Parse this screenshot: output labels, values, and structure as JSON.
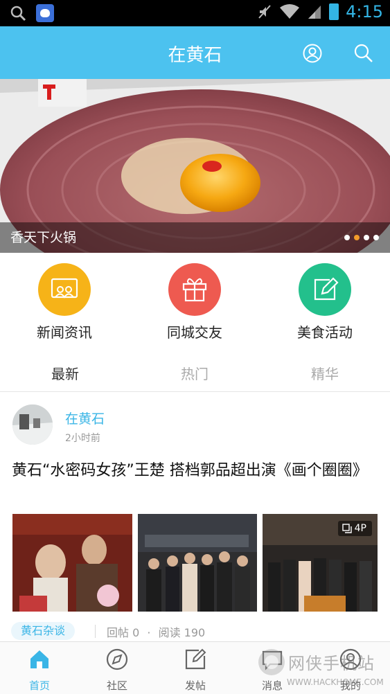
{
  "status_bar": {
    "time": "4:15",
    "icons": [
      "search-icon",
      "baidu-app-icon",
      "mute-icon",
      "wifi-icon",
      "signal-icon",
      "battery-icon"
    ]
  },
  "header": {
    "title": "在黄石",
    "icons": [
      "user-icon",
      "search-icon"
    ],
    "color": "#4cc2ef"
  },
  "banner": {
    "caption": "香天下火锅",
    "slide_count": 4,
    "active_slide": 2
  },
  "quick_links": [
    {
      "label": "新闻资讯",
      "icon": "news-icon",
      "color": "#f6b318"
    },
    {
      "label": "同城交友",
      "icon": "gift-icon",
      "color": "#ee5a50"
    },
    {
      "label": "美食活动",
      "icon": "edit-icon",
      "color": "#23c08c"
    }
  ],
  "tabs": [
    {
      "label": "最新",
      "active": true
    },
    {
      "label": "热门",
      "active": false
    },
    {
      "label": "精华",
      "active": false
    }
  ],
  "post": {
    "author": "在黄石",
    "time": "2小时前",
    "title": "黄石“水密码女孩”王楚 搭档郭品超出演《画个圈圈》",
    "photo_count": "4P",
    "tag": "黄石杂谈",
    "replies": "回帖 0",
    "reads": "阅读 190",
    "meta_separator": "·"
  },
  "bottom_nav": [
    {
      "label": "首页",
      "icon": "home-icon",
      "active": true
    },
    {
      "label": "社区",
      "icon": "compass-icon",
      "active": false
    },
    {
      "label": "发帖",
      "icon": "compose-icon",
      "active": false
    },
    {
      "label": "消息",
      "icon": "message-icon",
      "active": false
    },
    {
      "label": "我的",
      "icon": "profile-icon",
      "active": false
    }
  ],
  "watermark": {
    "text": "网侠手机站",
    "url": "WWW.HACKHOME.COM"
  },
  "colors": {
    "accent": "#3ab5e6",
    "status_time": "#33b5e5"
  }
}
